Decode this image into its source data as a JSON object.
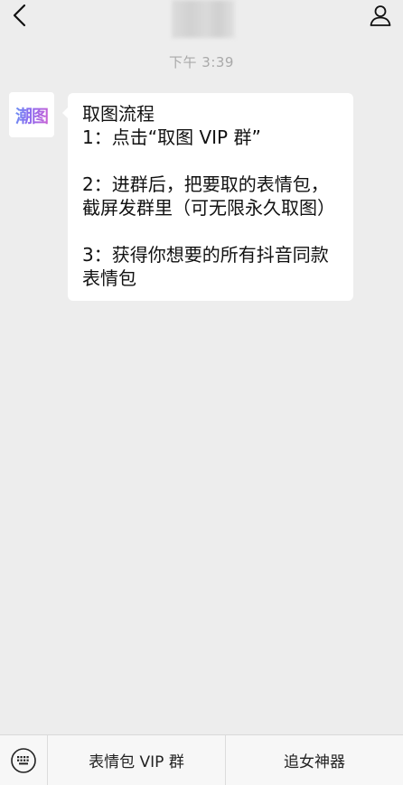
{
  "header": {
    "back_icon": "chevron-left-icon",
    "profile_icon": "person-icon"
  },
  "chat": {
    "timestamp": "下午 3:39",
    "avatar_text": "潮图",
    "message": {
      "line1": "取图流程",
      "line2": "1：点击“取图 VIP 群”",
      "line3": "2：进群后，把要取的表情包，截屏发群里（可无限永久取图）",
      "line4": "3：获得你想要的所有抖音同款表情包"
    }
  },
  "bottom_menu": {
    "keyboard_icon": "keyboard-icon",
    "item1": "表情包 VIP 群",
    "item2": "追女神器"
  }
}
